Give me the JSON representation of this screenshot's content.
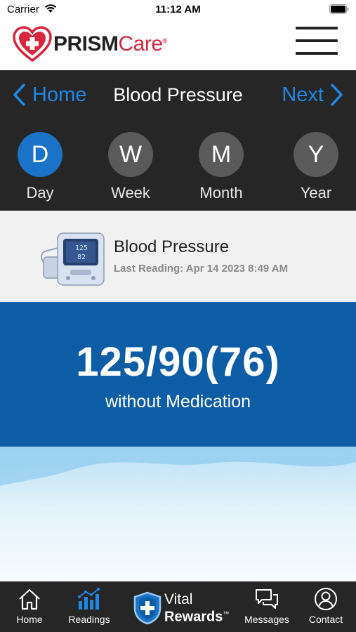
{
  "status_bar": {
    "carrier": "Carrier",
    "time": "11:12 AM"
  },
  "header": {
    "logo_prism": "PRISM",
    "logo_care": "Care",
    "logo_reg": "®",
    "menu_icon": "hamburger-menu-icon"
  },
  "nav": {
    "back_label": "Home",
    "title": "Blood Pressure",
    "next_label": "Next",
    "accent_color": "#1e88e5"
  },
  "periods": [
    {
      "letter": "D",
      "label": "Day",
      "active": true
    },
    {
      "letter": "W",
      "label": "Week",
      "active": false
    },
    {
      "letter": "M",
      "label": "Month",
      "active": false
    },
    {
      "letter": "Y",
      "label": "Year",
      "active": false
    }
  ],
  "reading": {
    "title": "Blood Pressure",
    "last_reading": "Last Reading: Apr 14 2023 8:49 AM",
    "device_icon": "blood-pressure-monitor-icon"
  },
  "value": {
    "main": "125/90(76)",
    "sub": "without Medication",
    "background_color": "#0d5da6"
  },
  "tab_bar": {
    "tabs": [
      {
        "label": "Home",
        "icon": "home-icon",
        "active": false
      },
      {
        "label": "Readings",
        "icon": "readings-chart-icon",
        "active": true
      },
      {
        "label": "Messages",
        "icon": "messages-icon",
        "active": false
      },
      {
        "label": "Contact",
        "icon": "contact-icon",
        "active": false
      }
    ],
    "vital_line1": "Vital",
    "vital_line2": "Rewards",
    "vital_tm": "™"
  }
}
